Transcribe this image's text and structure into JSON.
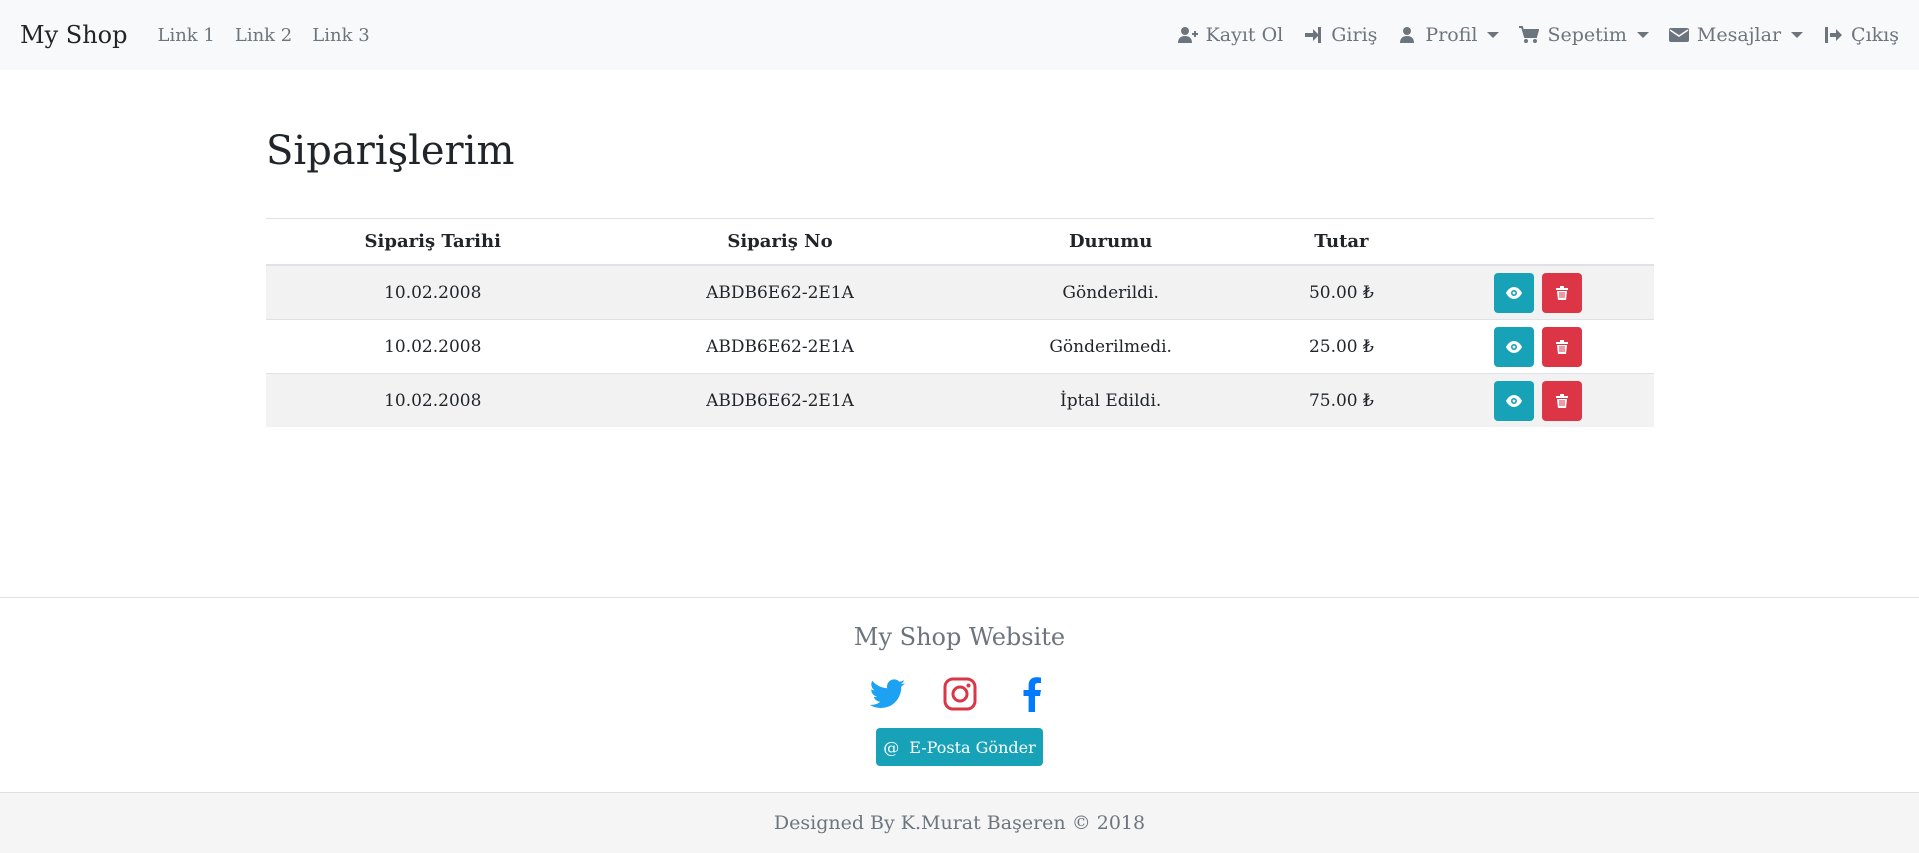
{
  "navbar": {
    "brand": "My Shop",
    "links": [
      "Link 1",
      "Link 2",
      "Link 3"
    ],
    "right": [
      {
        "label": "Kayıt Ol",
        "icon": "user-plus-icon",
        "dropdown": false
      },
      {
        "label": "Giriş",
        "icon": "sign-in-icon",
        "dropdown": false
      },
      {
        "label": "Profil",
        "icon": "user-icon",
        "dropdown": true
      },
      {
        "label": "Sepetim",
        "icon": "cart-icon",
        "dropdown": true
      },
      {
        "label": "Mesajlar",
        "icon": "envelope-icon",
        "dropdown": true
      },
      {
        "label": "Çıkış",
        "icon": "sign-out-icon",
        "dropdown": false
      }
    ]
  },
  "main": {
    "title": "Siparişlerim",
    "table": {
      "headers": [
        "Sipariş Tarihi",
        "Sipariş No",
        "Durumu",
        "Tutar",
        ""
      ],
      "rows": [
        {
          "date": "10.02.2008",
          "order_no": "ABDB6E62-2E1A",
          "status": "Gönderildi.",
          "amount": "50.00 ₺"
        },
        {
          "date": "10.02.2008",
          "order_no": "ABDB6E62-2E1A",
          "status": "Gönderilmedi.",
          "amount": "25.00 ₺"
        },
        {
          "date": "10.02.2008",
          "order_no": "ABDB6E62-2E1A",
          "status": "İptal Edildi.",
          "amount": "75.00 ₺"
        }
      ],
      "row_actions": [
        "eye-icon",
        "trash-icon"
      ]
    }
  },
  "footer": {
    "title": "My Shop Website",
    "social": [
      "twitter-icon",
      "instagram-icon",
      "facebook-icon"
    ],
    "email_button": "E-Posta Gönder",
    "copyright": "Designed By K.Murat Başeren © 2018"
  },
  "colors": {
    "info": "#17a2b8",
    "danger": "#dc3545",
    "twitter": "#1da1f2",
    "instagram": "#dc3545",
    "facebook": "#007bff",
    "muted": "#6c757d"
  }
}
